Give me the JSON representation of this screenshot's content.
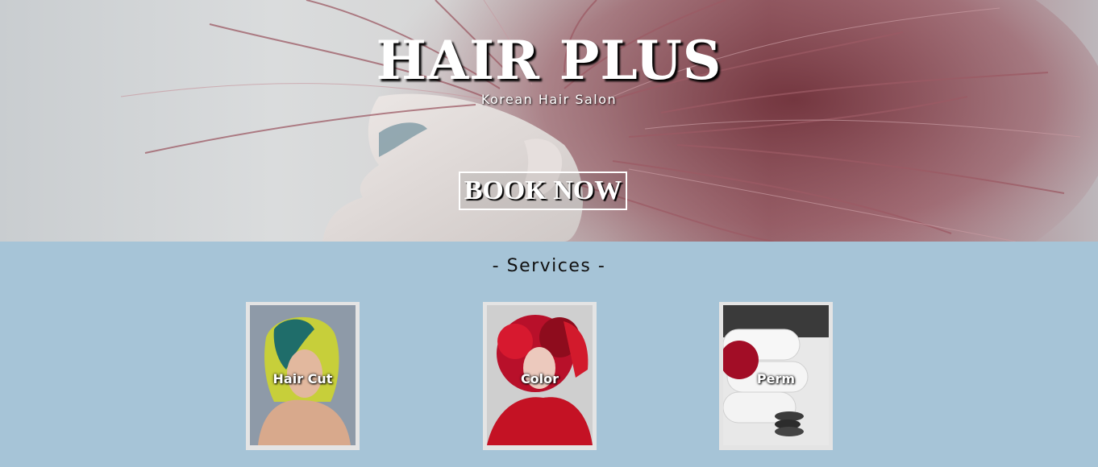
{
  "hero": {
    "title": "HAIR PLUS",
    "subtitle": "Korean Hair Salon",
    "cta_label": "BOOK NOW",
    "image": "woman-with-flying-pink-hair"
  },
  "services": {
    "heading": "- Services -",
    "items": [
      {
        "label": "Hair Cut",
        "image": "woman-with-green-yellow-hair"
      },
      {
        "label": "Color",
        "image": "woman-with-red-hair"
      },
      {
        "label": "Perm",
        "image": "rolled-towels-with-red-flower-and-stones"
      }
    ]
  },
  "colors": {
    "services_background": "#a6c4d7",
    "card_frame": "#e4e4e4",
    "hair_pink": "#a46a72"
  }
}
